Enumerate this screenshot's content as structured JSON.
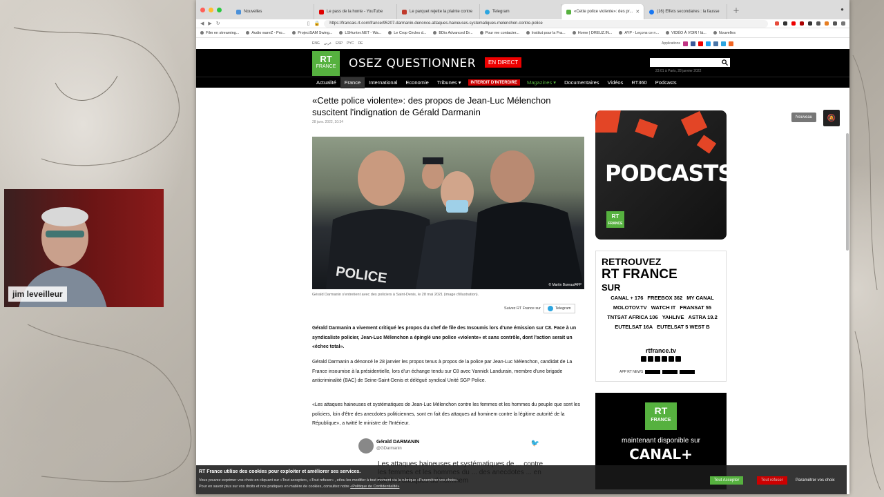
{
  "browser": {
    "tabs": [
      {
        "label": "Nouvelles",
        "color": "#4a90d9"
      },
      {
        "label": "Le pass de la honte - YouTube",
        "color": "#e00000"
      },
      {
        "label": "Le parquet rejette la plainte contre",
        "color": "#c0392b"
      },
      {
        "label": "Telegram",
        "color": "#2ca5e0"
      },
      {
        "label": "«Cette police violente»: des pr...",
        "color": "#56b13f"
      },
      {
        "label": "(16) Effets secondaires : la fausse",
        "color": "#1877f2"
      }
    ],
    "url": "https://francais.rt.com/france/95207-darmanin-denonce-attaques-haineuses-systematiques-melenchon-contre-police",
    "bookmarks": [
      "Film en streaming...",
      "Audio wareZ - Pro...",
      "ProjectSAM Swing...",
      "LSHunter.NET - Wa...",
      "Le Crop Circles d...",
      "BDio Advanced Dr...",
      "Pour me contacter...",
      "Institut pour la Fra...",
      "Home | DREUZ.IN...",
      "AYP - Leçons ce n...",
      "VIDÉO À VOIR ! lä...",
      "Nouvelles"
    ]
  },
  "site": {
    "languages": [
      "ENG",
      "عربي",
      "ESP",
      "PYC",
      "DE"
    ],
    "applications": "Applications",
    "logo_top": "RT",
    "logo_bottom": "FRANCE",
    "slogan": "OSEZ QUESTIONNER",
    "live_label": "EN DIRECT",
    "datetime": "23:01 à Paris, 28 janvier 2022",
    "nav": [
      "Actualité",
      "France",
      "International",
      "Economie",
      "Tribunes ▾",
      "INTERDIT D'INTERDIRE",
      "Magazines ▾",
      "Documentaires",
      "Vidéos",
      "RT360",
      "Podcasts"
    ]
  },
  "article": {
    "title": "«Cette police violente»: des propos de Jean-Luc Mélenchon suscitent l'indignation de Gérald Darmanin",
    "date": "28 janv. 2022, 10:34",
    "photo_credit": "© Martin Bureau/AFP",
    "caption": "Gérald Darmanin s'entretient avec des policiers à Saint-Denis, le 28 mai 2021 (image d'illustration).",
    "follow_label": "Suivez RT France sur",
    "telegram_label": "Telegram",
    "lead": "Gérald Darmanin a vivement critiqué les propos du chef de file des Insoumis lors d'une émission sur C8. Face à un syndicaliste policier, Jean-Luc Mélenchon a épinglé une police «violente» et sans contrôle, dont l'action serait un «échec total».",
    "p1": "Gérald Darmanin a dénoncé le 28 janvier les propos tenus à propos de la police par Jean-Luc Mélenchon, candidat de La France insoumise à la présidentielle, lors d'un échange tendu sur C8 avec Yannick Landurain, membre d'une brigade anticriminalité (BAC) de Seine-Saint-Denis et délégué syndical Unité SGP Police.",
    "p2": "«Les attaques haineuses et systématiques de Jean-Luc Mélenchon contre les femmes et les hommes du peuple que sont les policiers, loin d'être des anecdotes politiciennes, sont en fait des attaques ad hominem contre la légitime autorité de la République», a twitté le ministre de l'Intérieur.",
    "tweet_name": "Gérald DARMANIN",
    "tweet_handle": "@GDarmanin",
    "tweet_text": "Les attaques haineuses et systématiques de ... contre les femmes et les hommes du ... des anecdotes ... en fait des attaques ad hominem"
  },
  "sidebar": {
    "podcasts_title": "PODCASTS",
    "rt_top": "RT",
    "rt_bottom": "FRANCE",
    "retrouvez": "RETROUVEZ",
    "rt_france": "RT FRANCE",
    "sur": "SUR",
    "channels": [
      "CANAL + 176",
      "FREEBOX 362",
      "MY CANAL",
      "MOLOTOV.TV",
      "WATCH IT",
      "FRANSAT 55",
      "TNTSAT AFRICA 106",
      "YAHLIVE",
      "ASTRA 19.2",
      "EUTELSAT 16A",
      "EUTELSAT 5 WEST B"
    ],
    "site_url": "rtfrance.tv",
    "apps_label": "APP RT NEWS",
    "dispo": "maintenant disponible sur",
    "canal_label": "CANAL+",
    "nouveau_label": "Nouveau"
  },
  "cookie": {
    "title": "RT France utilise des cookies pour exploiter et améliorer ses services.",
    "line1": "Vous pouvez exprimer vos choix en cliquant sur «Tout accepter», «Tout refuser» , et/ou les modifier à tout moment via la rubrique «Paramétrer vos choix».",
    "line2": "Pour en savoir plus sur vos droits et nos pratiques en matière de cookies, consultez notre",
    "policy_link": "«Politique de Confidentialité»",
    "accept_label": "Tout Accepter",
    "refuse_label": "Tout refuser",
    "param_label": "Paramétrer vos choix"
  },
  "webcam": {
    "name": "jim leveilleur"
  },
  "colors": {
    "rt_green": "#56b13f",
    "live_red": "#ee0000",
    "podcast_orange": "#e34526"
  }
}
